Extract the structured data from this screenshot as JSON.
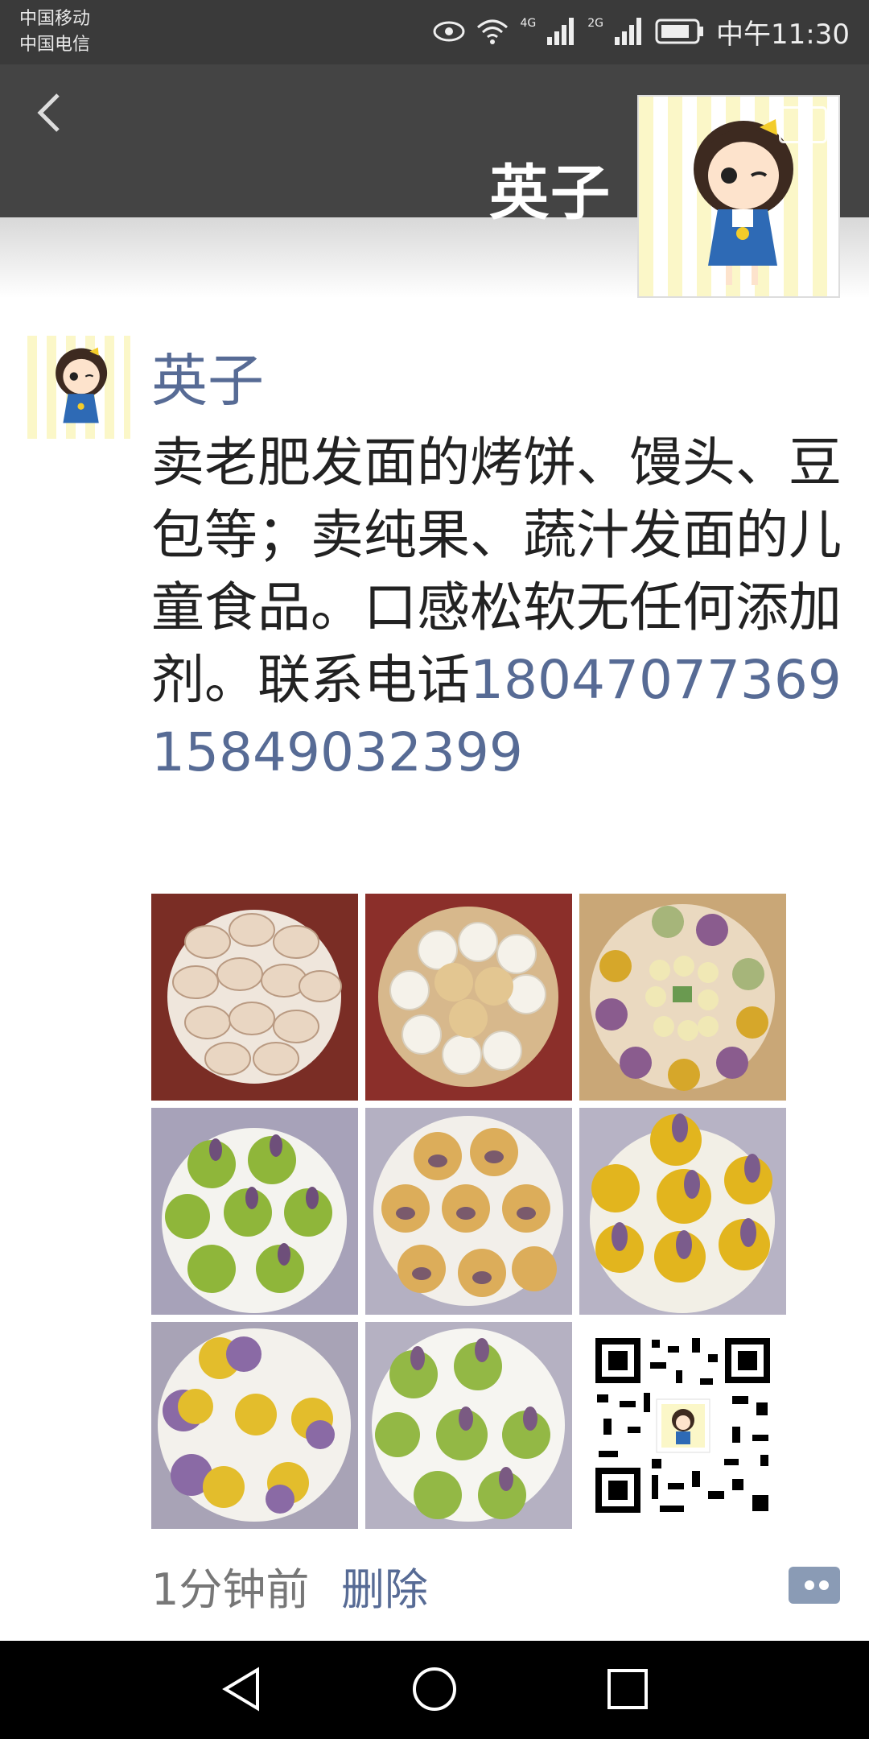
{
  "status_bar": {
    "carrier_1": "中国移动",
    "carrier_2": "中国电信",
    "network_1": "4G",
    "network_2": "2G",
    "time": "中午11:30"
  },
  "header": {
    "title": "英子",
    "back_icon": "chevron-left-icon",
    "camera_icon": "camera-icon"
  },
  "post": {
    "author": "英子",
    "text_before_phone": "卖老肥发面的烤饼、馒头、豆包等；卖纯果、蔬汁发面的儿童食品。口感松软无任何添加剂。联系电话",
    "phone_1": "18047077369",
    "phone_2": "15849032399",
    "images": [
      {
        "label": "baked-flatbreads"
      },
      {
        "label": "steamed-buns"
      },
      {
        "label": "colorful-animal-buns"
      },
      {
        "label": "green-bird-buns"
      },
      {
        "label": "pig-buns"
      },
      {
        "label": "yellow-bird-buns"
      },
      {
        "label": "purple-yellow-buns"
      },
      {
        "label": "green-chick-buns"
      },
      {
        "label": "qr-code"
      }
    ],
    "time_ago": "1分钟前",
    "delete_label": "删除",
    "comment_icon": "comment-dots-icon"
  },
  "colors": {
    "link": "#576b95",
    "header_bg": "#444444"
  }
}
